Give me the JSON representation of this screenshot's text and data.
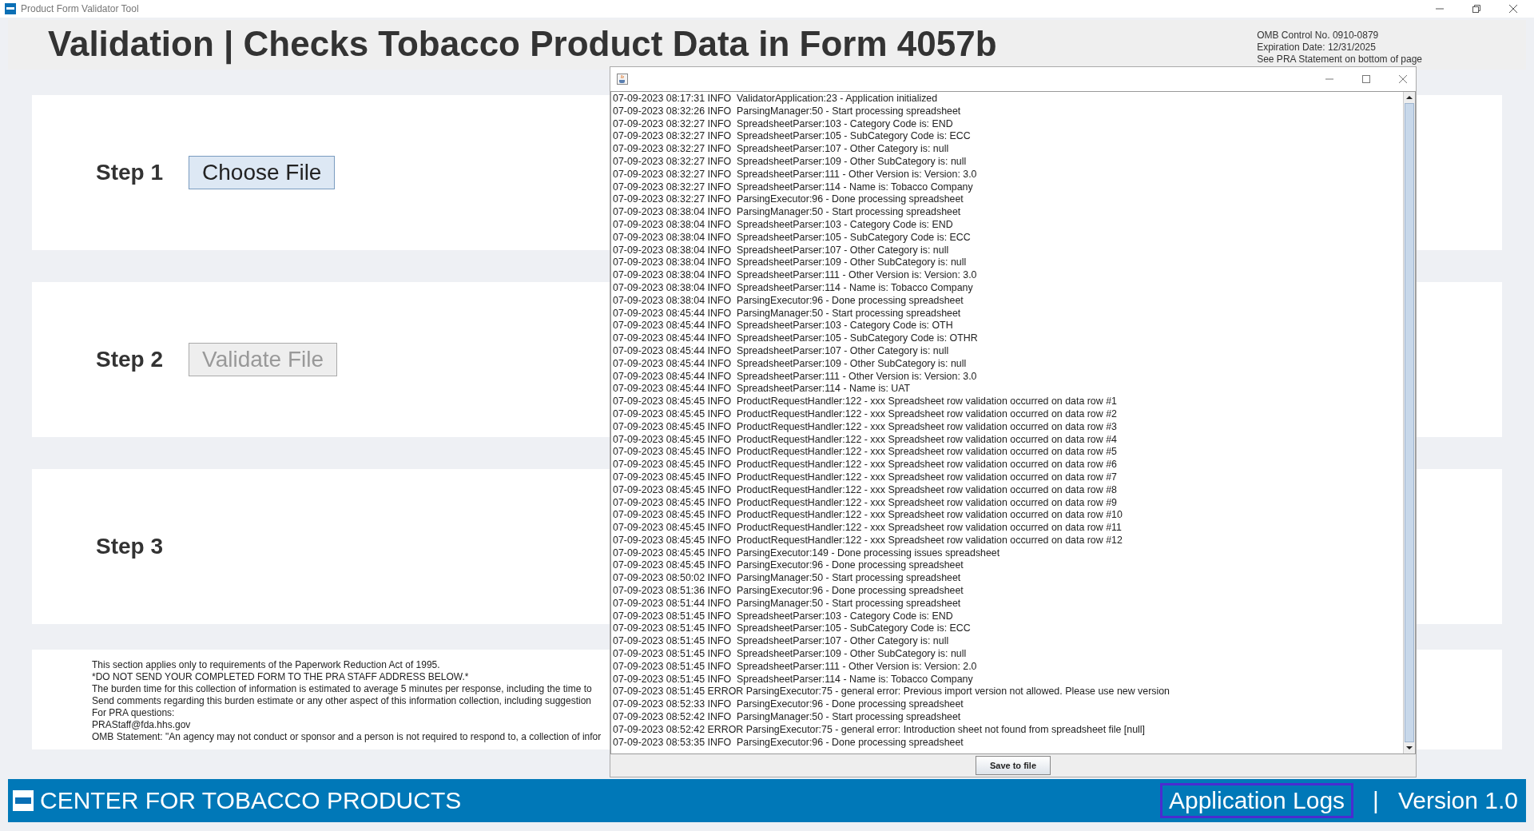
{
  "window": {
    "title": "Product Form Validator Tool"
  },
  "header": {
    "title": "Validation | Checks Tobacco Product Data in Form 4057b",
    "omb_lines": [
      "OMB Control No. 0910-0879",
      "Expiration Date: 12/31/2025",
      "See PRA Statement on bottom of page"
    ]
  },
  "steps": [
    {
      "label": "Step 1",
      "button": {
        "label": "Choose File",
        "disabled": false
      }
    },
    {
      "label": "Step 2",
      "button": {
        "label": "Validate File",
        "disabled": true
      }
    },
    {
      "label": "Step 3"
    }
  ],
  "pra_lines": [
    "This section applies only to requirements of the Paperwork Reduction Act of 1995.",
    "*DO NOT SEND YOUR COMPLETED FORM TO THE PRA STAFF ADDRESS BELOW.*",
    "The burden time for this collection of information is estimated to average 5 minutes per response, including the time to",
    "Send comments regarding this burden estimate or any other aspect of this information collection, including suggestion",
    "For PRA questions:",
    "PRAStaff@fda.hhs.gov",
    "OMB Statement: \"An agency may not conduct or sponsor and a person is not required to respond to, a collection of infor"
  ],
  "footer": {
    "org": "CENTER FOR TOBACCO PRODUCTS",
    "logs_link": {
      "label": "Application Logs",
      "focused": true
    },
    "separator": "|",
    "version": "Version 1.0"
  },
  "log_window": {
    "lines": [
      "07-09-2023 08:17:31 INFO  ValidatorApplication:23 - Application initialized",
      "07-09-2023 08:32:26 INFO  ParsingManager:50 - Start processing spreadsheet",
      "07-09-2023 08:32:27 INFO  SpreadsheetParser:103 - Category Code is: END",
      "07-09-2023 08:32:27 INFO  SpreadsheetParser:105 - SubCategory Code is: ECC",
      "07-09-2023 08:32:27 INFO  SpreadsheetParser:107 - Other Category is: null",
      "07-09-2023 08:32:27 INFO  SpreadsheetParser:109 - Other SubCategory is: null",
      "07-09-2023 08:32:27 INFO  SpreadsheetParser:111 - Other Version is: Version: 3.0",
      "07-09-2023 08:32:27 INFO  SpreadsheetParser:114 - Name is: Tobacco Company",
      "07-09-2023 08:32:27 INFO  ParsingExecutor:96 - Done processing spreadsheet",
      "07-09-2023 08:38:04 INFO  ParsingManager:50 - Start processing spreadsheet",
      "07-09-2023 08:38:04 INFO  SpreadsheetParser:103 - Category Code is: END",
      "07-09-2023 08:38:04 INFO  SpreadsheetParser:105 - SubCategory Code is: ECC",
      "07-09-2023 08:38:04 INFO  SpreadsheetParser:107 - Other Category is: null",
      "07-09-2023 08:38:04 INFO  SpreadsheetParser:109 - Other SubCategory is: null",
      "07-09-2023 08:38:04 INFO  SpreadsheetParser:111 - Other Version is: Version: 3.0",
      "07-09-2023 08:38:04 INFO  SpreadsheetParser:114 - Name is: Tobacco Company",
      "07-09-2023 08:38:04 INFO  ParsingExecutor:96 - Done processing spreadsheet",
      "07-09-2023 08:45:44 INFO  ParsingManager:50 - Start processing spreadsheet",
      "07-09-2023 08:45:44 INFO  SpreadsheetParser:103 - Category Code is: OTH",
      "07-09-2023 08:45:44 INFO  SpreadsheetParser:105 - SubCategory Code is: OTHR",
      "07-09-2023 08:45:44 INFO  SpreadsheetParser:107 - Other Category is: null",
      "07-09-2023 08:45:44 INFO  SpreadsheetParser:109 - Other SubCategory is: null",
      "07-09-2023 08:45:44 INFO  SpreadsheetParser:111 - Other Version is: Version: 3.0",
      "07-09-2023 08:45:44 INFO  SpreadsheetParser:114 - Name is: UAT",
      "07-09-2023 08:45:45 INFO  ProductRequestHandler:122 - xxx Spreadsheet row validation occurred on data row #1",
      "07-09-2023 08:45:45 INFO  ProductRequestHandler:122 - xxx Spreadsheet row validation occurred on data row #2",
      "07-09-2023 08:45:45 INFO  ProductRequestHandler:122 - xxx Spreadsheet row validation occurred on data row #3",
      "07-09-2023 08:45:45 INFO  ProductRequestHandler:122 - xxx Spreadsheet row validation occurred on data row #4",
      "07-09-2023 08:45:45 INFO  ProductRequestHandler:122 - xxx Spreadsheet row validation occurred on data row #5",
      "07-09-2023 08:45:45 INFO  ProductRequestHandler:122 - xxx Spreadsheet row validation occurred on data row #6",
      "07-09-2023 08:45:45 INFO  ProductRequestHandler:122 - xxx Spreadsheet row validation occurred on data row #7",
      "07-09-2023 08:45:45 INFO  ProductRequestHandler:122 - xxx Spreadsheet row validation occurred on data row #8",
      "07-09-2023 08:45:45 INFO  ProductRequestHandler:122 - xxx Spreadsheet row validation occurred on data row #9",
      "07-09-2023 08:45:45 INFO  ProductRequestHandler:122 - xxx Spreadsheet row validation occurred on data row #10",
      "07-09-2023 08:45:45 INFO  ProductRequestHandler:122 - xxx Spreadsheet row validation occurred on data row #11",
      "07-09-2023 08:45:45 INFO  ProductRequestHandler:122 - xxx Spreadsheet row validation occurred on data row #12",
      "07-09-2023 08:45:45 INFO  ParsingExecutor:149 - Done processing issues spreadsheet",
      "07-09-2023 08:45:45 INFO  ParsingExecutor:96 - Done processing spreadsheet",
      "07-09-2023 08:50:02 INFO  ParsingManager:50 - Start processing spreadsheet",
      "07-09-2023 08:51:36 INFO  ParsingExecutor:96 - Done processing spreadsheet",
      "07-09-2023 08:51:44 INFO  ParsingManager:50 - Start processing spreadsheet",
      "07-09-2023 08:51:45 INFO  SpreadsheetParser:103 - Category Code is: END",
      "07-09-2023 08:51:45 INFO  SpreadsheetParser:105 - SubCategory Code is: ECC",
      "07-09-2023 08:51:45 INFO  SpreadsheetParser:107 - Other Category is: null",
      "07-09-2023 08:51:45 INFO  SpreadsheetParser:109 - Other SubCategory is: null",
      "07-09-2023 08:51:45 INFO  SpreadsheetParser:111 - Other Version is: Version: 2.0",
      "07-09-2023 08:51:45 INFO  SpreadsheetParser:114 - Name is: Tobacco Company",
      "07-09-2023 08:51:45 ERROR ParsingExecutor:75 - general error: Previous import version not allowed. Please use new version",
      "07-09-2023 08:52:33 INFO  ParsingExecutor:96 - Done processing spreadsheet",
      "07-09-2023 08:52:42 INFO  ParsingManager:50 - Start processing spreadsheet",
      "07-09-2023 08:52:42 ERROR ParsingExecutor:75 - general error: Introduction sheet not found from spreadsheet file [null]",
      "07-09-2023 08:53:35 INFO  ParsingExecutor:96 - Done processing spreadsheet"
    ],
    "save_button": "Save to file"
  }
}
